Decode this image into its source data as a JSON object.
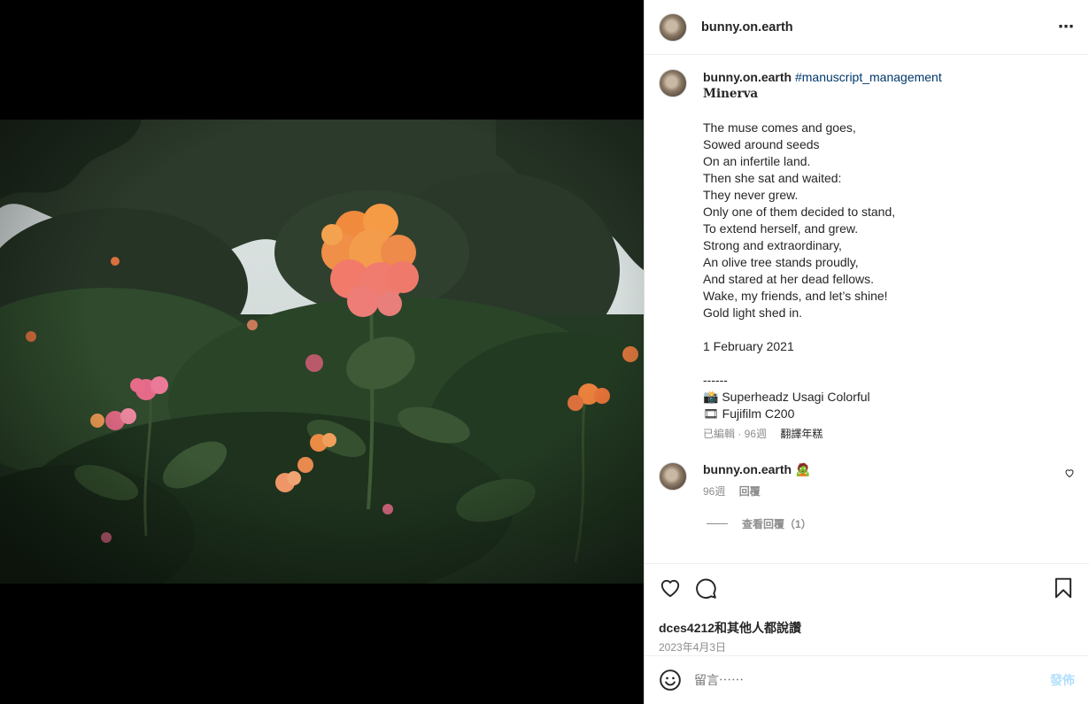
{
  "post": {
    "username": "bunny.on.earth",
    "more_icon": "more-options-icon"
  },
  "caption": {
    "username": "bunny.on.earth",
    "hashtag": "#manuscript_management",
    "title": "Minerva",
    "lines": [
      "",
      "The muse comes and goes,",
      "Sowed around seeds",
      "On an infertile land.",
      "Then she sat and waited:",
      "They never grew.",
      "Only one of them decided to stand,",
      "To extend herself, and grew.",
      "Strong and extraordinary,",
      "An olive tree stands proudly,",
      "And stared at her dead fellows.",
      "Wake, my friends, and let’s shine!",
      "Gold light shed in.",
      "",
      "1 February 2021",
      "",
      "------",
      "📸 Superheadz Usagi Colorful",
      "🎞 Fujifilm C200"
    ],
    "meta": "已編輯 · 96週",
    "translate": "翻譯年糕"
  },
  "reply": {
    "username": "bunny.on.earth",
    "emoji": "🧟",
    "age": "96週",
    "reply_label": "回覆",
    "view_replies": "查看回覆（1）"
  },
  "actions": {
    "likes_text": "dces4212和其他人都說讚",
    "date": "2023年4月3日"
  },
  "composer": {
    "placeholder": "留言⋯⋯",
    "post_label": "發佈"
  },
  "colors": {
    "hashtag": "#00376b",
    "post_button_disabled": "#b2dffc",
    "secondary_text": "#8e8e8e"
  }
}
